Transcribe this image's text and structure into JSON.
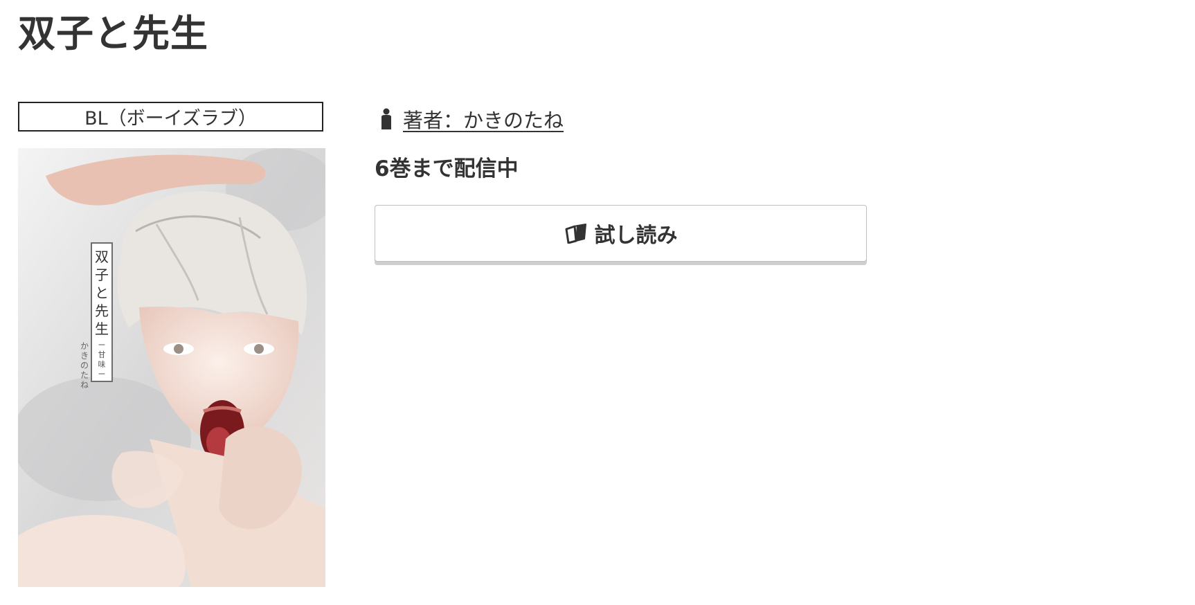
{
  "page": {
    "title": "双子と先生"
  },
  "genre": {
    "label": "BL（ボーイズラブ）"
  },
  "cover": {
    "title": "双子と先生",
    "subtitle": "ー甘味ー",
    "author": "かきのたね"
  },
  "author": {
    "label": "著者：かきのたね",
    "icon": "person-icon"
  },
  "volumes": {
    "text": "6巻まで配信中"
  },
  "trial": {
    "label": "試し読み",
    "icon": "open-book-icon"
  }
}
